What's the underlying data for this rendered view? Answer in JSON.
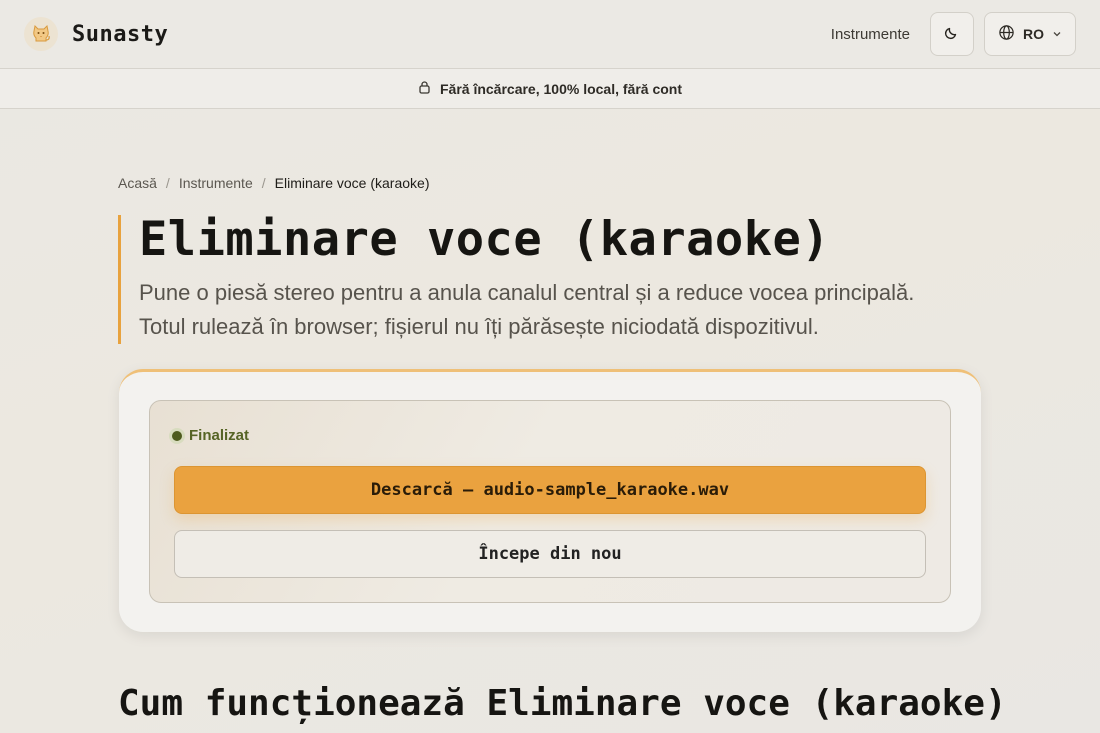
{
  "header": {
    "brand_name": "Sunasty",
    "logo_icon": "cat-icon",
    "nav_tools_label": "Instrumente",
    "theme_icon": "moon-icon",
    "language_code": "RO",
    "language_icon": "globe-icon"
  },
  "notice": {
    "icon": "lock-icon",
    "text": "Fără încărcare, 100% local, fără cont"
  },
  "breadcrumb": {
    "home": "Acasă",
    "separator": "/",
    "tools": "Instrumente",
    "current": "Eliminare voce (karaoke)"
  },
  "hero": {
    "title": "Eliminare voce (karaoke)",
    "line1": "Pune o piesă stereo pentru a anula canalul central și a reduce vocea principală.",
    "line2": "Totul rulează în browser; fișierul nu îți părăsește niciodată dispozitivul."
  },
  "result": {
    "status": "Finalizat",
    "download_label": "Descarcă — audio-sample_karaoke.wav",
    "restart_label": "Începe din nou"
  },
  "section": {
    "title": "Cum funcționează Eliminare voce (karaoke)"
  },
  "colors": {
    "accent": "#eaa23f",
    "status_green": "#566425",
    "background": "#eae8e3"
  }
}
